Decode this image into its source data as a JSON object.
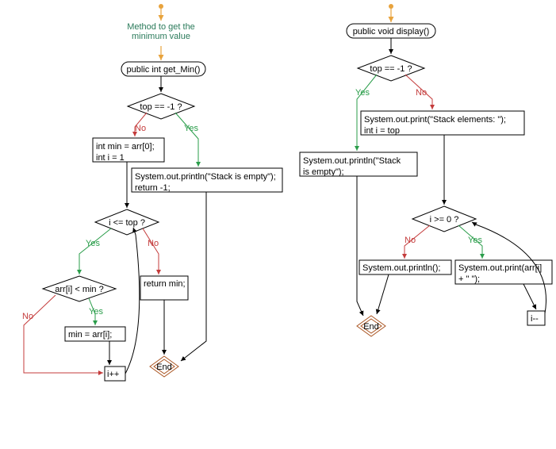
{
  "left": {
    "annotation": "Method to get the\nminimum value",
    "start": "public int get_Min()",
    "dec1": "top == -1 ?",
    "dec1_yes": "Yes",
    "dec1_no": "No",
    "proc_min_init": "int min = arr[0];\nint i = 1",
    "proc_empty": "System.out.println(\"Stack is empty\");\nreturn -1;",
    "dec2": "i <= top ?",
    "dec2_yes": "Yes",
    "dec2_no": "No",
    "dec3": "arr[i] < min ?",
    "dec3_yes": "Yes",
    "dec3_no": "No",
    "proc_assign": "min = arr[i];",
    "proc_inc": "i++",
    "proc_return": "return min;",
    "end": "End"
  },
  "right": {
    "start": "public void display()",
    "dec1": "top == -1 ?",
    "dec1_yes": "Yes",
    "dec1_no": "No",
    "proc_header": "System.out.print(\"Stack elements: \");\nint i = top",
    "proc_empty": "System.out.println(\"Stack\nis empty\");",
    "dec2": "i >= 0 ?",
    "dec2_yes": "Yes",
    "dec2_no": "No",
    "proc_println": "System.out.println();",
    "proc_print": "System.out.print(arr[i]\n+ \" \");",
    "proc_dec": "i--",
    "end": "End"
  }
}
